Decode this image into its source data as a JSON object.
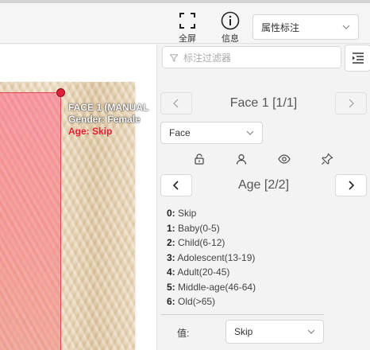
{
  "toolbar": {
    "fullscreen_label": "全屏",
    "info_label": "信息",
    "attribute_select": "属性标注"
  },
  "canvas": {
    "face_label": {
      "line1": "FACE 1 (MANUAL",
      "line2": "Gender: Female",
      "line3": "Age: Skip"
    },
    "colors": {
      "box": "#e0485a",
      "age_text": "#e81a2d"
    }
  },
  "panel": {
    "filter_placeholder": "标注过滤器",
    "face_nav": {
      "title": "Face 1 [1/1]"
    },
    "type_select": "Face",
    "attr_nav": {
      "title": "Age [2/2]"
    },
    "options": [
      {
        "key": "0:",
        "label": "Skip"
      },
      {
        "key": "1:",
        "label": "Baby(0-5)"
      },
      {
        "key": "2:",
        "label": "Child(6-12)"
      },
      {
        "key": "3:",
        "label": "Adolescent(13-19)"
      },
      {
        "key": "4:",
        "label": "Adult(20-45)"
      },
      {
        "key": "5:",
        "label": "Middle-age(46-64)"
      },
      {
        "key": "6:",
        "label": "Old(>65)"
      }
    ],
    "value_label": "值:",
    "value_select": "Skip"
  }
}
